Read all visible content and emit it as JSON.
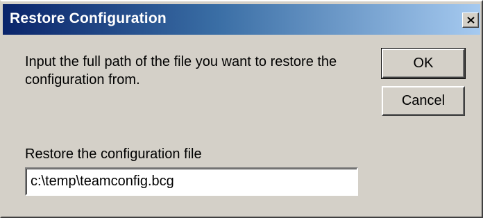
{
  "window": {
    "title": "Restore Configuration",
    "close_icon": "close-icon"
  },
  "message": "Input the full path of the file you want to restore the configuration from.",
  "buttons": {
    "ok_label": "OK",
    "cancel_label": "Cancel"
  },
  "field": {
    "label": "Restore the configuration file",
    "value": "c:\\temp\\teamconfig.bcg"
  },
  "colors": {
    "titlebar_start": "#0a246a",
    "titlebar_end": "#a6caf0",
    "dialog_face": "#d4d0c8"
  }
}
